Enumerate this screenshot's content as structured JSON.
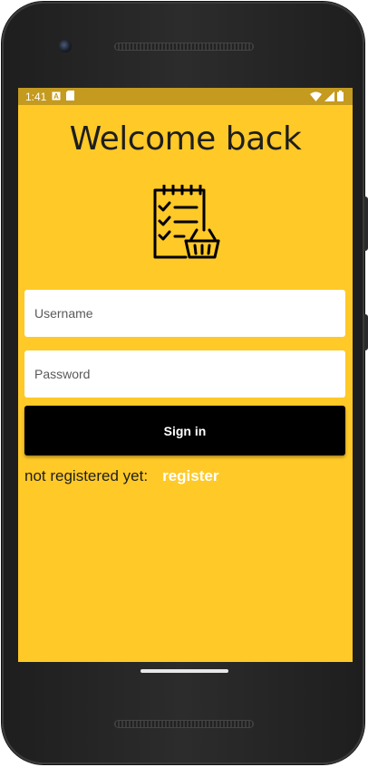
{
  "status_bar": {
    "time": "1:41",
    "icons_left": [
      "a-notification-icon",
      "sd-card-icon"
    ],
    "icons_right": [
      "wifi-icon",
      "signal-icon",
      "battery-icon"
    ]
  },
  "login": {
    "title": "Welcome back",
    "logo_icon": "checklist-basket-icon",
    "username_placeholder": "Username",
    "password_placeholder": "Password",
    "signin_label": "Sign in",
    "not_registered_text": "not registered yet:",
    "register_link": "register"
  },
  "colors": {
    "background": "#ffc927",
    "status_bar": "#c49a1f",
    "button": "#000000",
    "link": "#ffffff"
  }
}
